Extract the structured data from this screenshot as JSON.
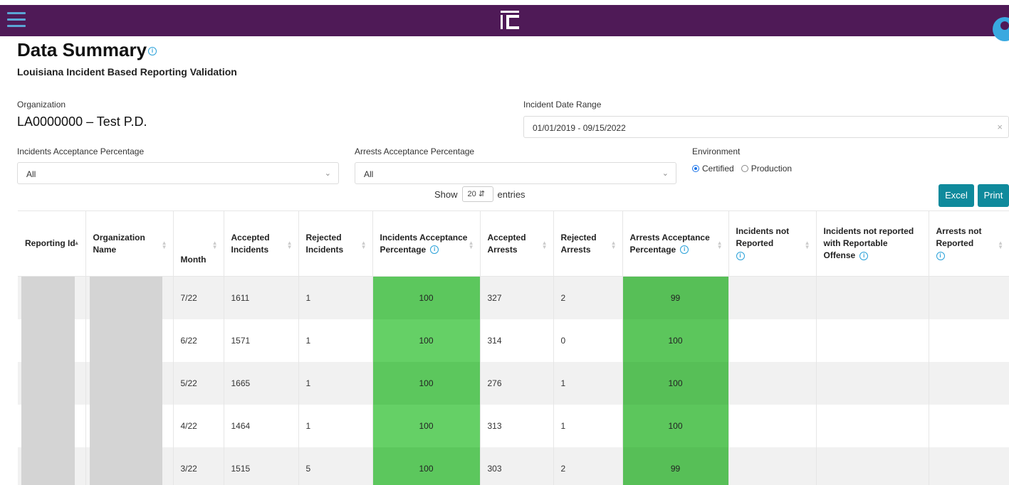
{
  "app": {
    "logo_icon": "ic-logo-icon",
    "brand_color": "#4f1a57"
  },
  "page": {
    "title": "Data Summary",
    "subtitle": "Louisiana Incident Based Reporting Validation"
  },
  "filters": {
    "organization_label": "Organization",
    "organization_value": "LA0000000 – Test P.D.",
    "date_range_label": "Incident Date Range",
    "date_range_value": "01/01/2019 - 09/15/2022",
    "incidents_pct_label": "Incidents Acceptance Percentage",
    "incidents_pct_value": "All",
    "arrests_pct_label": "Arrests Acceptance Percentage",
    "arrests_pct_value": "All",
    "environment_label": "Environment",
    "environment_options": [
      "Certified",
      "Production"
    ],
    "environment_selected": "Certified"
  },
  "controls": {
    "show_label": "Show",
    "page_length": "20",
    "entries_label": "entries",
    "excel_label": "Excel",
    "print_label": "Print"
  },
  "table": {
    "headers": [
      "Reporting Id",
      "Organization Name",
      "Month",
      "Accepted Incidents",
      "Rejected Incidents",
      "Incidents Acceptance Percentage",
      "Accepted Arrests",
      "Rejected Arrests",
      "Arrests Acceptance Percentage",
      "Incidents not Reported",
      "Incidents not reported with Reportable Offense",
      "Arrests not Reported"
    ],
    "rows": [
      {
        "month": "7/22",
        "accepted_incidents": "1611",
        "rejected_incidents": "1",
        "incidents_pct": "100",
        "accepted_arrests": "327",
        "rejected_arrests": "2",
        "arrests_pct": "99"
      },
      {
        "month": "6/22",
        "accepted_incidents": "1571",
        "rejected_incidents": "1",
        "incidents_pct": "100",
        "accepted_arrests": "314",
        "rejected_arrests": "0",
        "arrests_pct": "100"
      },
      {
        "month": "5/22",
        "accepted_incidents": "1665",
        "rejected_incidents": "1",
        "incidents_pct": "100",
        "accepted_arrests": "276",
        "rejected_arrests": "1",
        "arrests_pct": "100"
      },
      {
        "month": "4/22",
        "accepted_incidents": "1464",
        "rejected_incidents": "1",
        "incidents_pct": "100",
        "accepted_arrests": "313",
        "rejected_arrests": "1",
        "arrests_pct": "100"
      },
      {
        "month": "3/22",
        "accepted_incidents": "1515",
        "rejected_incidents": "5",
        "incidents_pct": "100",
        "accepted_arrests": "303",
        "rejected_arrests": "2",
        "arrests_pct": "99"
      }
    ]
  },
  "colors": {
    "accent": "#0f8a9c",
    "pct_green": "#65d066",
    "info": "#2aa1d9"
  }
}
